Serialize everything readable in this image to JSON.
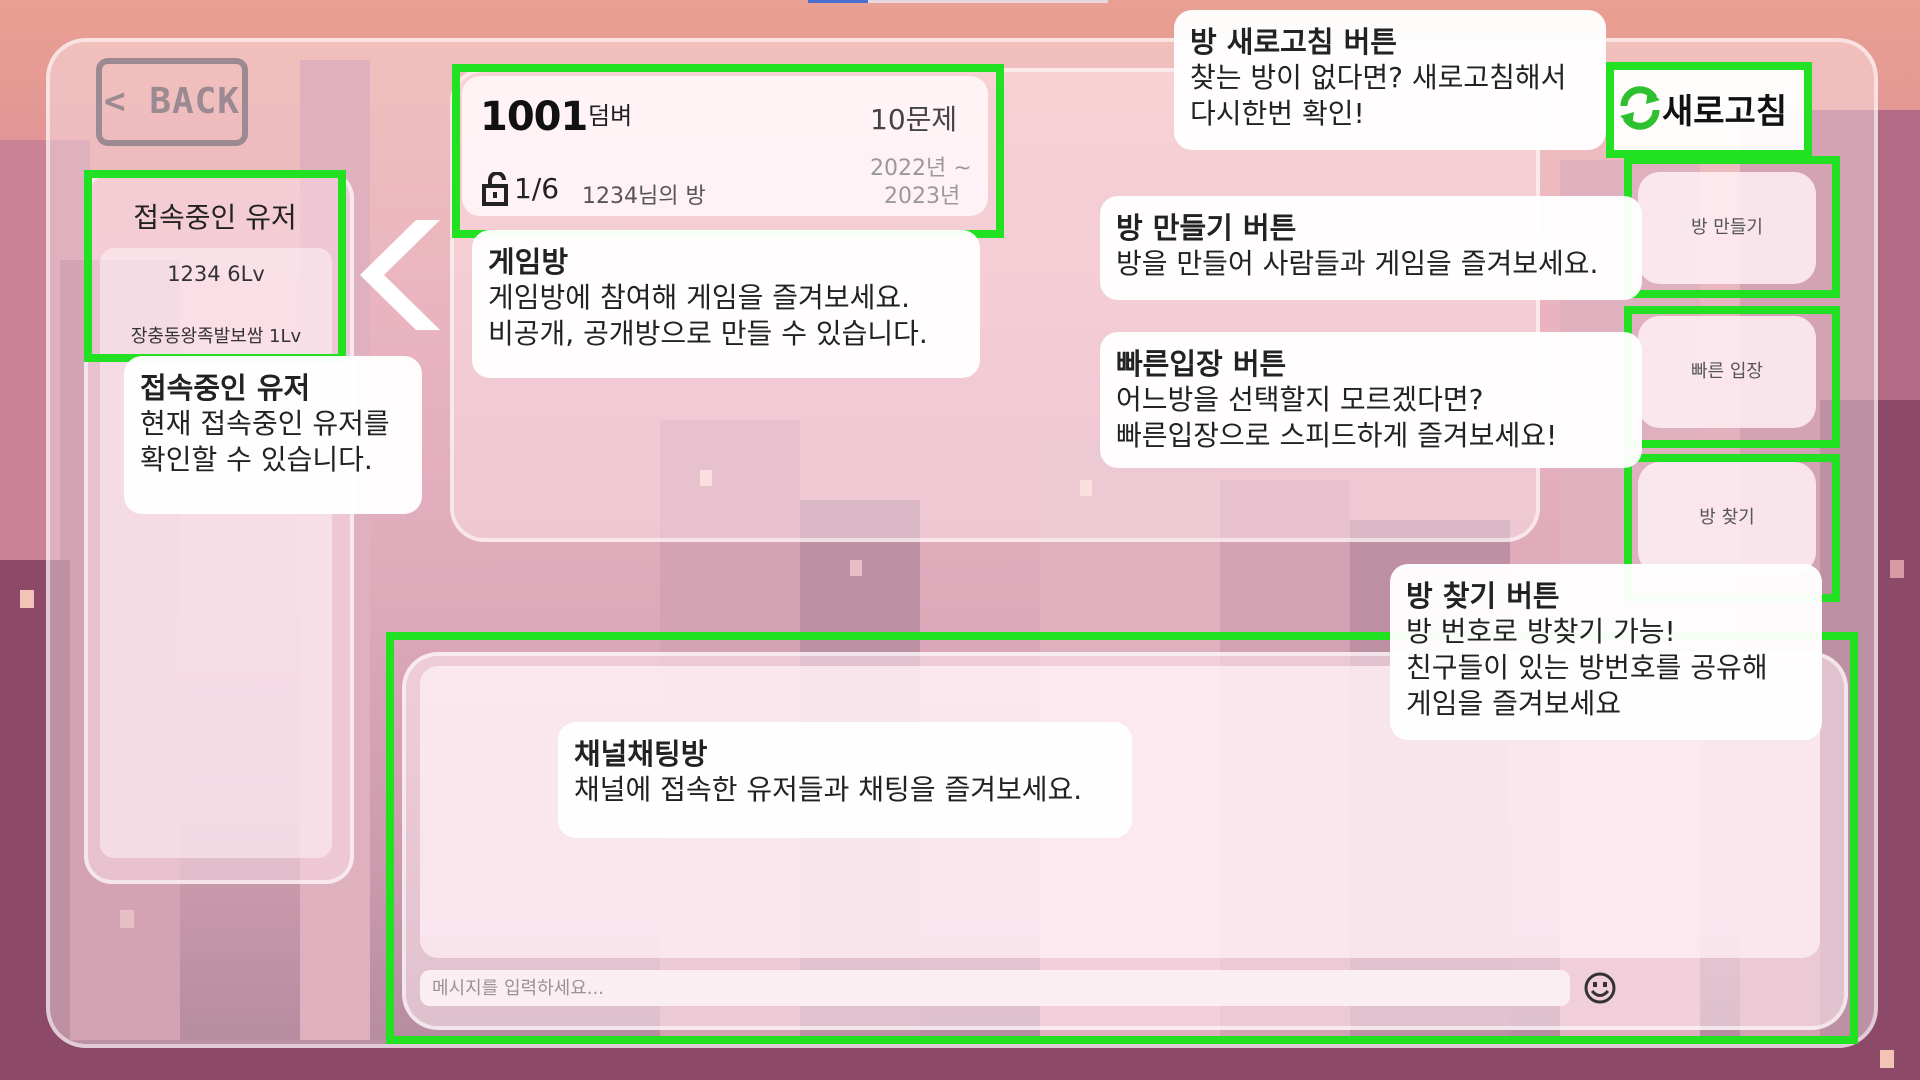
{
  "nav": {
    "back_label": "< BACK"
  },
  "users_panel": {
    "title": "접속중인 유저",
    "users": [
      {
        "name_level": "1234 6Lv"
      },
      {
        "name_level": "장충동왕족발보쌈 1Lv"
      }
    ]
  },
  "room_card": {
    "number": "1001",
    "name": "덤벼",
    "question_count": "10문제",
    "players": "1/6",
    "owner_text": "1234님의 방",
    "period_start": "2022년 ~",
    "period_end": "2023년"
  },
  "refresh_button": {
    "label": "새로고침",
    "icon": "refresh-icon"
  },
  "side_buttons": {
    "create_room": "방 만들기",
    "quick_join": "빠른 입장",
    "find_room": "방 찾기"
  },
  "chat": {
    "input_placeholder": "메시지를 입력하세요...",
    "emoji_icon": "emoji-icon"
  },
  "tooltips": {
    "refresh": {
      "title": "방 새로고침 버튼",
      "desc": "찾는 방이 없다면? 새로고침해서\n다시한번 확인!"
    },
    "create": {
      "title": "방 만들기 버튼",
      "desc": "방을 만들어 사람들과 게임을 즐겨보세요."
    },
    "quick": {
      "title": "빠른입장 버튼",
      "desc": "어느방을 선택할지 모르겠다면?\n빠른입장으로 스피드하게 즐겨보세요!"
    },
    "find": {
      "title": "방 찾기 버튼",
      "desc": "방 번호로 방찾기 가능!\n친구들이 있는 방번호를 공유해\n게임을 즐겨보세요"
    },
    "game_room": {
      "title": "게임방",
      "desc": "게임방에 참여해 게임을 즐겨보세요.\n비공개, 공개방으로 만들 수 있습니다."
    },
    "users": {
      "title": "접속중인 유저",
      "desc": "현재 접속중인 유저를\n확인할 수 있습니다."
    },
    "chat": {
      "title": "채널채팅방",
      "desc": "채널에 접속한 유저들과 채팅을 즐겨보세요."
    }
  },
  "colors": {
    "highlight": "#22e022",
    "refresh_icon": "#2fc02f"
  }
}
